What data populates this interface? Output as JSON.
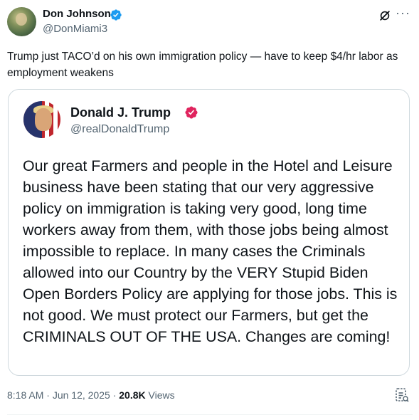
{
  "post": {
    "author": {
      "name": "Don Johnson",
      "handle": "@DonMiami3",
      "verified": true
    },
    "text": "Trump just TACO’d on his own immigration policy — have to keep $4/hr labor as employment weakens",
    "quoted_post": {
      "author": {
        "name": "Donald J. Trump",
        "handle": "@realDonaldTrump",
        "verified": true
      },
      "text": "Our great Farmers and people in the Hotel and Leisure business have been stating that our very aggressive policy on immigration is taking very good, long time workers away from them, with those jobs being almost impossible to replace. In many cases the Criminals allowed into our Country by the VERY Stupid Biden Open Borders Policy are applying for those jobs. This is not good. We must protect our Farmers, but get the CRIMINALS OUT OF THE USA. Changes are coming!"
    },
    "meta": {
      "time": "8:18 AM",
      "separator": "·",
      "date": "Jun 12, 2025",
      "views_count": "20.8K",
      "views_label": "Views"
    }
  },
  "icons": {
    "verified": "verified-badge-icon",
    "grok": "grok-icon",
    "more": "more-icon",
    "analytics": "analytics-icon"
  },
  "colors": {
    "verified_blue": "#1d9bf0",
    "gov_verified_pink": "#e0245e",
    "secondary_text": "#536471",
    "border": "#cfd9de"
  }
}
